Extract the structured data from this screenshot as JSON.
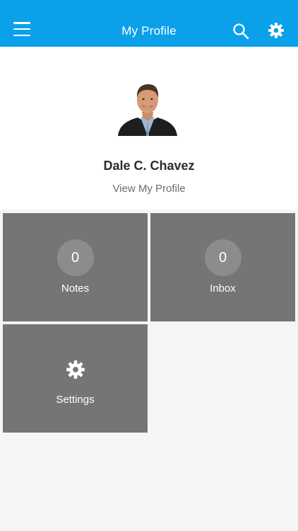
{
  "header": {
    "title": "My Profile",
    "menu_icon": "hamburger-menu-icon",
    "search_icon": "search-icon",
    "settings_icon": "gear-icon",
    "background_color": "#0aa1ea"
  },
  "profile": {
    "name": "Dale C. Chavez",
    "view_profile_label": "View My Profile",
    "avatar": "profile-photo"
  },
  "tiles": [
    {
      "label": "Notes",
      "count": "0"
    },
    {
      "label": "Inbox",
      "count": "0"
    },
    {
      "label": "Settings",
      "icon": "gear-icon"
    }
  ],
  "colors": {
    "tile": "#757575",
    "badge": "#8c8c8c",
    "background": "#f5f5f5"
  }
}
